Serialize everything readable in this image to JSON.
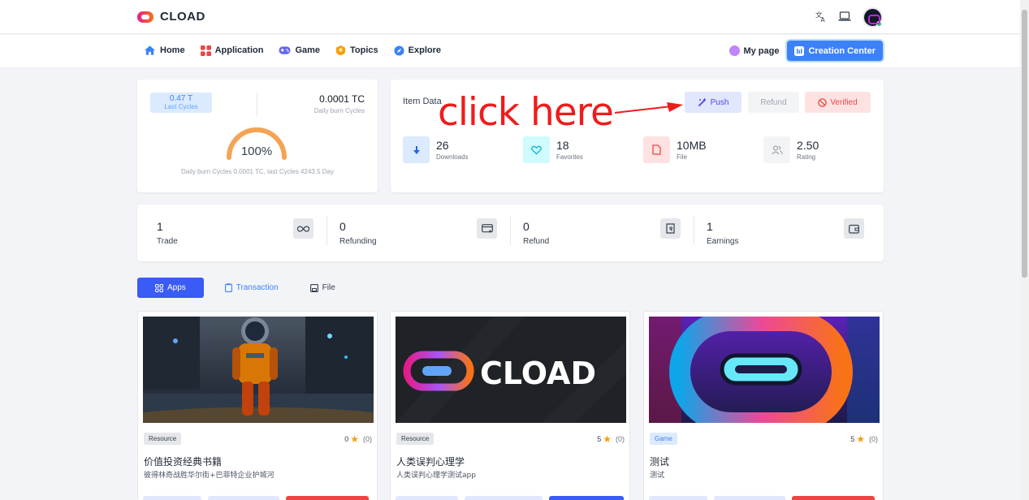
{
  "brand": {
    "name": "CLOAD"
  },
  "topbar": {
    "translate_icon": "translate-icon",
    "laptop_icon": "laptop-icon"
  },
  "nav": {
    "items": [
      {
        "label": "Home",
        "icon": "home-icon"
      },
      {
        "label": "Application",
        "icon": "grid-icon"
      },
      {
        "label": "Game",
        "icon": "gamepad-icon"
      },
      {
        "label": "Topics",
        "icon": "topics-icon"
      },
      {
        "label": "Explore",
        "icon": "compass-icon"
      }
    ],
    "my_page": "My page",
    "creation_center": "Creation Center"
  },
  "cycles": {
    "last_value": "0.47 T",
    "last_label": "Last Cycles",
    "daily_value": "0.0001 TC",
    "daily_label": "Daily burn Cycles",
    "gauge_percent": 100,
    "gauge_text": "100%",
    "note": "Daily burn Cycles 0.0001 TC, last Cycles 4243.5 Day"
  },
  "item_data": {
    "title": "Item Data",
    "annotation": "click here",
    "buttons": {
      "push": "Push",
      "refund": "Refund",
      "verified": "Verified"
    },
    "stats": [
      {
        "value": "26",
        "label": "Downloads"
      },
      {
        "value": "18",
        "label": "Favorites"
      },
      {
        "value": "10MB",
        "label": "File"
      },
      {
        "value": "2.50",
        "label": "Rating"
      }
    ]
  },
  "metrics": [
    {
      "value": "1",
      "label": "Trade"
    },
    {
      "value": "0",
      "label": "Refunding"
    },
    {
      "value": "0",
      "label": "Refund"
    },
    {
      "value": "1",
      "label": "Earnings"
    }
  ],
  "tabs": [
    {
      "label": "Apps"
    },
    {
      "label": "Transaction"
    },
    {
      "label": "File"
    }
  ],
  "apps": [
    {
      "tag": "Resource",
      "score": "0",
      "count": "(0)",
      "name": "价值投资经典书籍",
      "desc": "彼得林奇战胜华尔街+巴菲特企业护城河"
    },
    {
      "tag": "Resource",
      "score": "5",
      "count": "(0)",
      "name": "人类误判心理学",
      "desc": "人类误判心理学测试app",
      "thumb_text": "CLOAD"
    },
    {
      "tag": "Game",
      "score": "5",
      "count": "(0)",
      "name": "测试",
      "desc": "测试"
    }
  ]
}
